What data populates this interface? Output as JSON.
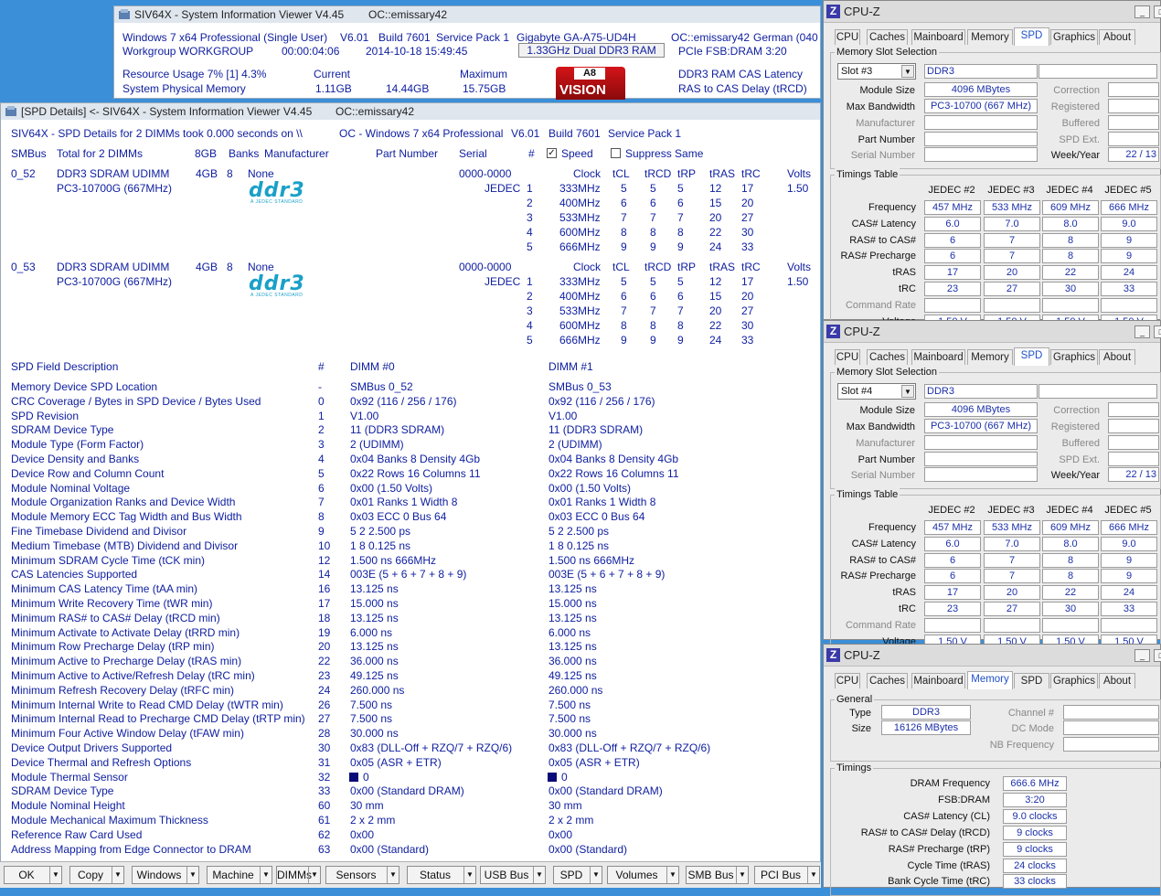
{
  "siv_main": {
    "title": "SIV64X - System Information Viewer V4.45",
    "title_host": "OC::emissary42",
    "l1": "Windows 7 x64 Professional (Single User)",
    "l1b": "V6.01",
    "l1c": "Build 7601",
    "l1d": "Service Pack 1",
    "l1e": "Gigabyte GA-A75-UD4H",
    "l1f": "OC::emissary42",
    "l1g": "German (040",
    "l2": "Workgroup WORKGROUP",
    "l2b": "00:00:04:06",
    "l2c": "2014-10-18 15:49:45",
    "ram_button": "1.33GHz Dual DDR3 RAM",
    "l2e": "PCIe FSB:DRAM 3:20",
    "l3": "Resource Usage 7% [1] 4.3%",
    "l3b": "Current",
    "l3c": "Maximum",
    "l3d": "DDR3 RAM CAS Latency",
    "l4": "System Physical Memory",
    "l4b": "1.11GB",
    "l4c": "14.44GB",
    "l4d": "15.75GB",
    "l4e": "RAS to CAS Delay (tRCD)",
    "badge_a": "A8",
    "badge_b": "VISION"
  },
  "spd": {
    "title": "[SPD Details] <- SIV64X - System Information Viewer V4.45",
    "title_host": "OC::emissary42",
    "summary": "SIV64X - SPD Details for 2 DIMMs took 0.000 seconds on \\\\",
    "summary_b": "OC - Windows 7 x64 Professional",
    "summary_c": "V6.01",
    "summary_d": "Build 7601",
    "summary_e": "Service Pack 1",
    "hdr": {
      "smbus": "SMBus",
      "total": "Total for 2 DIMMs",
      "size": "8GB",
      "banks": "Banks",
      "mfr": "Manufacturer",
      "part": "Part Number",
      "serial": "Serial",
      "num": "#",
      "speed": "Speed",
      "suppress": "Suppress Same"
    },
    "cols": [
      "Clock",
      "tCL",
      "tRCD",
      "tRP",
      "tRAS",
      "tRC",
      "Volts"
    ],
    "dimms": [
      {
        "addr": "0_52",
        "type": "DDR3 SDRAM UDIMM",
        "pc": "PC3-10700G (667MHz)",
        "size": "4GB",
        "banks": "8",
        "mfr": "None",
        "serial": "0000-0000",
        "jedec": "JEDEC",
        "volts": "1.50",
        "rows": [
          [
            "1",
            "333MHz",
            "5",
            "5",
            "5",
            "12",
            "17"
          ],
          [
            "2",
            "400MHz",
            "6",
            "6",
            "6",
            "15",
            "20"
          ],
          [
            "3",
            "533MHz",
            "7",
            "7",
            "7",
            "20",
            "27"
          ],
          [
            "4",
            "600MHz",
            "8",
            "8",
            "8",
            "22",
            "30"
          ],
          [
            "5",
            "666MHz",
            "9",
            "9",
            "9",
            "24",
            "33"
          ]
        ]
      },
      {
        "addr": "0_53",
        "type": "DDR3 SDRAM UDIMM",
        "pc": "PC3-10700G (667MHz)",
        "size": "4GB",
        "banks": "8",
        "mfr": "None",
        "serial": "0000-0000",
        "jedec": "JEDEC",
        "volts": "1.50",
        "rows": [
          [
            "1",
            "333MHz",
            "5",
            "5",
            "5",
            "12",
            "17"
          ],
          [
            "2",
            "400MHz",
            "6",
            "6",
            "6",
            "15",
            "20"
          ],
          [
            "3",
            "533MHz",
            "7",
            "7",
            "7",
            "20",
            "27"
          ],
          [
            "4",
            "600MHz",
            "8",
            "8",
            "8",
            "22",
            "30"
          ],
          [
            "5",
            "666MHz",
            "9",
            "9",
            "9",
            "24",
            "33"
          ]
        ]
      }
    ],
    "ddr3_logo": "ddr3",
    "ddr3_sub": "A JEDEC STANDARD",
    "fhdr": {
      "desc": "SPD Field Description",
      "num": "#",
      "d0": "DIMM #0",
      "d1": "DIMM #1"
    },
    "fields": [
      [
        "Memory Device SPD Location",
        "-",
        "SMBus 0_52",
        "SMBus 0_53"
      ],
      [
        "CRC Coverage / Bytes in SPD Device / Bytes Used",
        "0",
        "0x92  (116 / 256 / 176)",
        "0x92  (116 / 256 / 176)"
      ],
      [
        "SPD Revision",
        "1",
        "V1.00",
        "V1.00"
      ],
      [
        "SDRAM Device Type",
        "2",
        "11  (DDR3 SDRAM)",
        "11  (DDR3 SDRAM)"
      ],
      [
        "Module Type (Form Factor)",
        "3",
        "2  (UDIMM)",
        "2  (UDIMM)"
      ],
      [
        "Device Density and Banks",
        "4",
        "0x04  Banks 8  Density 4Gb",
        "0x04  Banks 8  Density 4Gb"
      ],
      [
        "Device Row and Column Count",
        "5",
        "0x22  Rows 16  Columns 11",
        "0x22  Rows 16  Columns 11"
      ],
      [
        "Module Nominal Voltage",
        "6",
        "0x00  (1.50 Volts)",
        "0x00  (1.50 Volts)"
      ],
      [
        "Module Organization Ranks and Device Width",
        "7",
        "0x01  Ranks 1  Width 8",
        "0x01  Ranks 1  Width 8"
      ],
      [
        "Module Memory ECC Tag Width and Bus Width",
        "8",
        "0x03    ECC 0     Bus 64",
        "0x03    ECC 0     Bus 64"
      ],
      [
        "Fine Timebase Dividend and Divisor",
        "9",
        "5  2  2.500 ps",
        "5  2  2.500 ps"
      ],
      [
        "Medium Timebase (MTB) Dividend and Divisor",
        "10",
        "1  8  0.125 ns",
        "1  8  0.125 ns"
      ],
      [
        "Minimum SDRAM Cycle Time (tCK min)",
        "12",
        "1.500 ns  666MHz",
        "1.500 ns  666MHz"
      ],
      [
        "CAS Latencies Supported",
        "14",
        "003E  (5 + 6 + 7 + 8 + 9)",
        "003E  (5 + 6 + 7 + 8 + 9)"
      ],
      [
        "Minimum CAS Latency Time (tAA min)",
        "16",
        "13.125 ns",
        "13.125 ns"
      ],
      [
        "Minimum Write Recovery Time (tWR min)",
        "17",
        "15.000 ns",
        "15.000 ns"
      ],
      [
        "Minimum RAS# to CAS# Delay (tRCD min)",
        "18",
        "13.125 ns",
        "13.125 ns"
      ],
      [
        "Minimum Activate to Activate Delay (tRRD min)",
        "19",
        "6.000 ns",
        "6.000 ns"
      ],
      [
        "Minimum Row Precharge Delay (tRP min)",
        "20",
        "13.125 ns",
        "13.125 ns"
      ],
      [
        "Minimum Active to Precharge Delay (tRAS min)",
        "22",
        "36.000 ns",
        "36.000 ns"
      ],
      [
        "Minimum Active to Active/Refresh Delay (tRC min)",
        "23",
        "49.125 ns",
        "49.125 ns"
      ],
      [
        "Minimum Refresh Recovery Delay (tRFC min)",
        "24",
        "260.000 ns",
        "260.000 ns"
      ],
      [
        "Minimum Internal Write to Read CMD Delay (tWTR min)",
        "26",
        "7.500 ns",
        "7.500 ns"
      ],
      [
        "Minimum Internal Read to Precharge CMD Delay (tRTP min)",
        "27",
        "7.500 ns",
        "7.500 ns"
      ],
      [
        "Minimum Four Active Window Delay (tFAW min)",
        "28",
        "30.000 ns",
        "30.000 ns"
      ],
      [
        "Device Output Drivers Supported",
        "30",
        "0x83  (DLL-Off + RZQ/7 + RZQ/6)",
        "0x83  (DLL-Off + RZQ/7 + RZQ/6)"
      ],
      [
        "Device Thermal and Refresh Options",
        "31",
        "0x05  (ASR + ETR)",
        "0x05  (ASR + ETR)"
      ],
      [
        "Module Thermal Sensor",
        "32",
        "0",
        "0"
      ],
      [
        "SDRAM Device Type",
        "33",
        "0x00  (Standard DRAM)",
        "0x00  (Standard DRAM)"
      ],
      [
        "Module Nominal Height",
        "60",
        "30 mm",
        "30 mm"
      ],
      [
        "Module Mechanical Maximum Thickness",
        "61",
        "2 x 2 mm",
        "2 x 2 mm"
      ],
      [
        "Reference Raw Card Used",
        "62",
        "0x00",
        "0x00"
      ],
      [
        "Address Mapping from Edge Connector to DRAM",
        "63",
        "0x00  (Standard)",
        "0x00  (Standard)"
      ]
    ],
    "buttons": [
      "OK",
      "Copy",
      "Windows",
      "Machine",
      "DIMMs",
      "Sensors",
      "Status",
      "USB Bus",
      "SPD",
      "Volumes",
      "SMB Bus",
      "PCI Bus"
    ]
  },
  "cpuz": {
    "title": "CPU-Z",
    "tabs": [
      "CPU",
      "Caches",
      "Mainboard",
      "Memory",
      "SPD",
      "Graphics",
      "About"
    ],
    "spd_labels": {
      "group": "Memory Slot Selection",
      "module_size": "Module Size",
      "max_bw": "Max Bandwidth",
      "manufacturer": "Manufacturer",
      "part": "Part Number",
      "serial": "Serial Number",
      "correction": "Correction",
      "registered": "Registered",
      "buffered": "Buffered",
      "spd_ext": "SPD Ext.",
      "week_year": "Week/Year",
      "timings": "Timings Table",
      "frequency": "Frequency",
      "cas": "CAS# Latency",
      "ras_cas": "RAS# to CAS#",
      "ras_pre": "RAS# Precharge",
      "tras": "tRAS",
      "trc": "tRC",
      "cmd": "Command Rate",
      "voltage": "Voltage"
    },
    "jedec_hdr": [
      "JEDEC #2",
      "JEDEC #3",
      "JEDEC #4",
      "JEDEC #5"
    ],
    "jedec": {
      "freq": [
        "457 MHz",
        "533 MHz",
        "609 MHz",
        "666 MHz"
      ],
      "cas": [
        "6.0",
        "7.0",
        "8.0",
        "9.0"
      ],
      "rcd": [
        "6",
        "7",
        "8",
        "9"
      ],
      "rp": [
        "6",
        "7",
        "8",
        "9"
      ],
      "tras": [
        "17",
        "20",
        "22",
        "24"
      ],
      "trc": [
        "23",
        "27",
        "30",
        "33"
      ],
      "volt": [
        "1.50 V",
        "1.50 V",
        "1.50 V",
        "1.50 V"
      ]
    },
    "slot3": {
      "slot": "Slot #3",
      "type": "DDR3",
      "size": "4096 MBytes",
      "bw": "PC3-10700 (667 MHz)",
      "wy": "22 / 13"
    },
    "slot4": {
      "slot": "Slot #4",
      "type": "DDR3",
      "size": "4096 MBytes",
      "bw": "PC3-10700 (667 MHz)",
      "wy": "22 / 13"
    },
    "mem": {
      "general": "General",
      "type_l": "Type",
      "type": "DDR3",
      "size_l": "Size",
      "size": "16126 MBytes",
      "channel_l": "Channel #",
      "dc_l": "DC Mode",
      "nb_l": "NB Frequency",
      "timings": "Timings",
      "rows": [
        [
          "DRAM Frequency",
          "666.6 MHz"
        ],
        [
          "FSB:DRAM",
          "3:20"
        ],
        [
          "CAS# Latency (CL)",
          "9.0 clocks"
        ],
        [
          "RAS# to CAS# Delay (tRCD)",
          "9 clocks"
        ],
        [
          "RAS# Precharge (tRP)",
          "9 clocks"
        ],
        [
          "Cycle Time (tRAS)",
          "24 clocks"
        ],
        [
          "Bank Cycle Time (tRC)",
          "33 clocks"
        ]
      ]
    }
  }
}
